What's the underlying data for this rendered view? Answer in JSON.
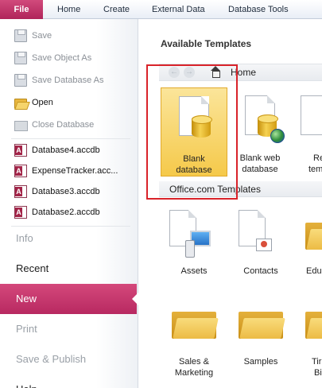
{
  "ribbon": {
    "tabs": [
      "File",
      "Home",
      "Create",
      "External Data",
      "Database Tools"
    ]
  },
  "backstage": {
    "commands": [
      {
        "label": "Save",
        "icon": "save-icon",
        "enabled": false
      },
      {
        "label": "Save Object As",
        "icon": "save-object-icon",
        "enabled": false
      },
      {
        "label": "Save Database As",
        "icon": "save-database-icon",
        "enabled": false
      },
      {
        "label": "Open",
        "icon": "open-folder-icon",
        "enabled": true
      },
      {
        "label": "Close Database",
        "icon": "close-database-icon",
        "enabled": false
      }
    ],
    "recent_files": [
      "Database4.accdb",
      "ExpenseTracker.acc...",
      "Database3.accdb",
      "Database2.accdb"
    ],
    "sections": [
      {
        "label": "Info",
        "state": "disabled"
      },
      {
        "label": "Recent",
        "state": "normal"
      },
      {
        "label": "New",
        "state": "active"
      },
      {
        "label": "Print",
        "state": "disabled"
      },
      {
        "label": "Save & Publish",
        "state": "disabled"
      },
      {
        "label": "Help",
        "state": "normal"
      }
    ]
  },
  "templates": {
    "heading": "Available Templates",
    "nav": {
      "back": "←",
      "forward": "→",
      "location": "Home"
    },
    "top_tiles": [
      {
        "line1": "Blank",
        "line2": "database",
        "selected": true
      },
      {
        "line1": "Blank web",
        "line2": "database",
        "selected": false
      },
      {
        "line1": "Re",
        "line2": "tem",
        "selected": false
      }
    ],
    "office_section_label": "Office.com Templates",
    "office_tiles": [
      {
        "line1": "Assets",
        "line2": ""
      },
      {
        "line1": "Contacts",
        "line2": ""
      },
      {
        "line1": "Edu",
        "line2": ""
      },
      {
        "line1": "Sales &",
        "line2": "Marketing"
      },
      {
        "line1": "Samples",
        "line2": ""
      },
      {
        "line1": "Tir",
        "line2": "Bi"
      }
    ]
  },
  "colors": {
    "file_tab": "#b0245a",
    "active_section": "#c23468",
    "selected_tile": "#f5c94a",
    "highlight_box": "#d9232a"
  }
}
